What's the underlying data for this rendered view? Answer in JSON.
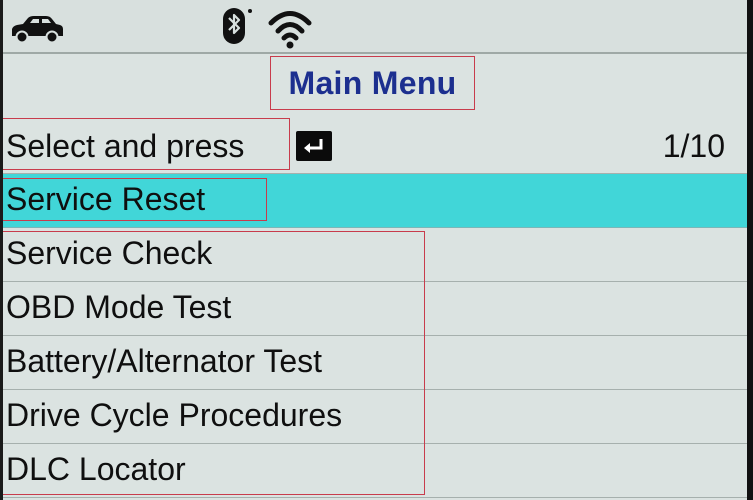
{
  "status_bar": {
    "icons": [
      "car-icon",
      "bluetooth-icon",
      "wifi-icon"
    ]
  },
  "header": {
    "title": "Main Menu"
  },
  "instruction": {
    "label": "Select and press",
    "icon": "enter-icon",
    "page_counter": "1/10"
  },
  "menu": {
    "selected_index": 0,
    "items": [
      {
        "label": "Service Reset"
      },
      {
        "label": "Service Check"
      },
      {
        "label": "OBD Mode Test"
      },
      {
        "label": "Battery/Alternator Test"
      },
      {
        "label": "Drive Cycle Procedures"
      },
      {
        "label": "DLC Locator"
      }
    ]
  },
  "colors": {
    "title": "#1c2f8f",
    "highlight": "#41d6d8",
    "background": "#dbe3e1",
    "annotation_box": "#c83c4c"
  }
}
